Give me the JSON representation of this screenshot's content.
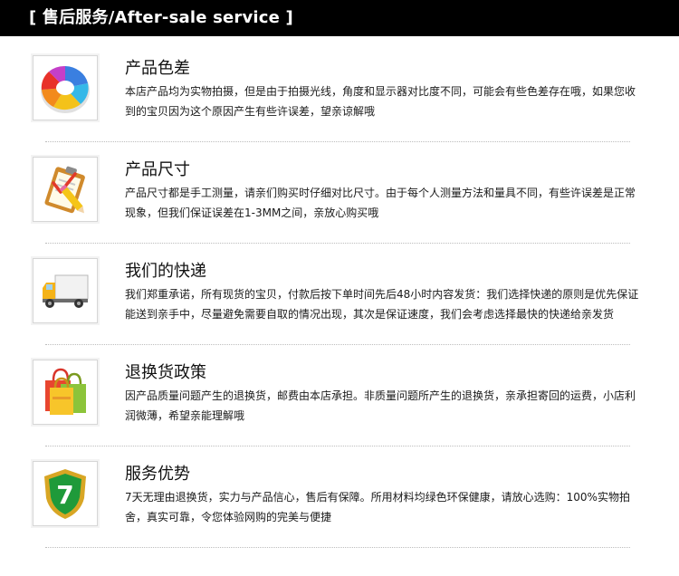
{
  "header": {
    "title": "[ 售后服务/After-sale service ]"
  },
  "sections": [
    {
      "title": "产品色差",
      "body": "本店产品均为实物拍摄，但是由于拍摄光线，角度和显示器对比度不同，可能会有些色差存在哦，如果您收到的宝贝因为这个原因产生有些许误差，望亲谅解哦",
      "icon": "color-wheel-icon"
    },
    {
      "title": "产品尺寸",
      "body": "产品尺寸都是手工测量，请亲们购买时仔细对比尺寸。由于每个人测量方法和量具不同，有些许误差是正常现象，但我们保证误差在1-3MM之间，亲放心购买哦",
      "icon": "clipboard-pencil-icon"
    },
    {
      "title": "我们的快递",
      "body": "我们郑重承诺，所有现货的宝贝，付款后按下单时间先后48小时内容发货：我们选择快递的原则是优先保证能送到亲手中，尽量避免需要自取的情况出现，其次是保证速度，我们会考虑选择最快的快递给亲发货",
      "icon": "delivery-truck-icon"
    },
    {
      "title": "退换货政策",
      "body": "因产品质量问题产生的退换货，邮费由本店承担。非质量问题所产生的退换货，亲承担寄回的运费，小店利润微薄，希望亲能理解哦",
      "icon": "shopping-bags-icon"
    },
    {
      "title": "服务优势",
      "body": "7天无理由退换货，实力与产品信心，售后有保障。所用材料均绿色环保健康，请放心选购：100%实物拍舍，真实可靠，令您体验网购的完美与便捷",
      "icon": "shield-7-icon",
      "badge_text": "7"
    }
  ]
}
